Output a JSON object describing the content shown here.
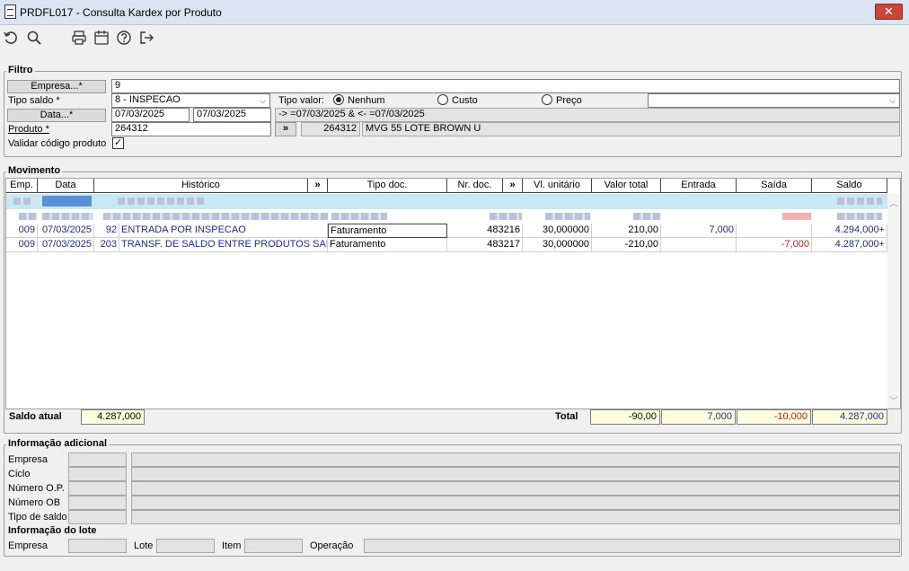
{
  "window": {
    "title": "PRDFL017 - Consulta Kardex por Produto",
    "close": "✕"
  },
  "toolbar": {
    "refresh": "↻",
    "search": "⚲",
    "print": "⎙",
    "calendar": "▦",
    "help": "?",
    "exit": "⇥"
  },
  "filtro": {
    "group_label": "Filtro",
    "empresa_btn": "Empresa...*",
    "empresa_value": "9",
    "tipo_saldo_label": "Tipo saldo *",
    "tipo_saldo_value": "8 - INSPECAO",
    "tipo_valor_label": "Tipo valor:",
    "radio_nenhum": "Nenhum",
    "radio_custo": "Custo",
    "radio_preco": "Preço",
    "data_btn": "Data...*",
    "data_ini": "07/03/2025",
    "data_fim": "07/03/2025",
    "data_expr": "-> =07/03/2025 & <- =07/03/2025",
    "produto_label": "Produto *",
    "produto_value": "264312",
    "produto_btn": "»",
    "produto_code": "264312",
    "produto_desc": "MVG 55 LOTE BROWN U",
    "validar_label": "Validar código produto",
    "validar_checked": "✓"
  },
  "movimento": {
    "group_label": "Movimento",
    "columns": [
      "Emp.",
      "Data",
      "Histórico",
      "»",
      "Tipo doc.",
      "Nr. doc.",
      "»",
      "Vl. unitário",
      "Valor total",
      "Entrada",
      "Saída",
      "Saldo"
    ],
    "rows": [
      {
        "emp": "009",
        "data": "07/03/2025",
        "cod": "92",
        "hist": "ENTRADA POR INSPECAO",
        "tipo": "Faturamento",
        "nr": "483216",
        "vl": "30,000000",
        "total": "210,00",
        "entrada": "7,000",
        "saida": "",
        "saldo": "4.294,000+"
      },
      {
        "emp": "009",
        "data": "07/03/2025",
        "cod": "203",
        "hist": "TRANSF. DE SALDO ENTRE PRODUTOS SAIDA",
        "tipo": "Faturamento",
        "nr": "483217",
        "vl": "30,000000",
        "total": "-210,00",
        "entrada": "",
        "saida": "-7,000",
        "saldo": "4.287,000+"
      }
    ],
    "saldo_atual_label": "Saldo atual",
    "saldo_atual_value": "4.287,000",
    "total_label": "Total",
    "total_valor": "-90,00",
    "total_entrada": "7,000",
    "total_saida": "-10,000",
    "total_saldo": "4.287,000",
    "scroll_up": "︿",
    "scroll_down": "﹀"
  },
  "info_adicional": {
    "group_label": "Informação adicional",
    "labels": [
      "Empresa",
      "Ciclo",
      "Número O.P.",
      "Número OB",
      "Tipo de saldo"
    ]
  },
  "info_lote": {
    "group_label": "Informação do lote",
    "empresa_label": "Empresa",
    "lote_label": "Lote",
    "item_label": "Item",
    "operacao_label": "Operação"
  },
  "colors": {
    "accent_blue": "#1c2c8c",
    "negative_red": "#d01818",
    "total_bg": "#fffde0",
    "close_red": "#c8463a"
  }
}
